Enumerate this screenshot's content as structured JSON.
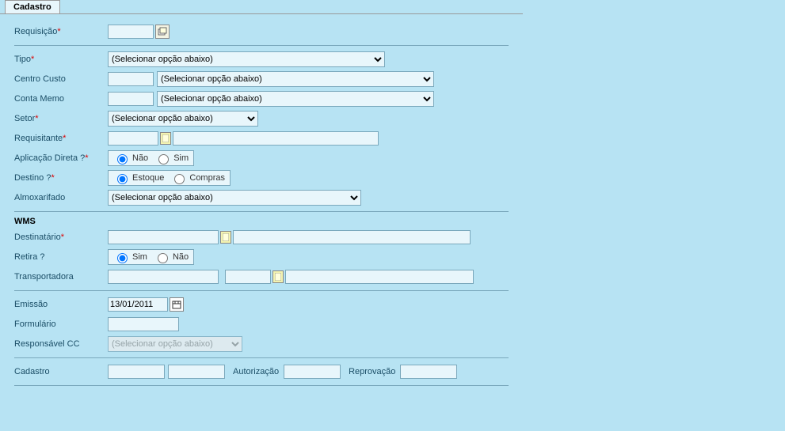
{
  "tab": {
    "title": "Cadastro"
  },
  "fields": {
    "requisicao": {
      "label": "Requisição",
      "value": ""
    },
    "tipo": {
      "label": "Tipo",
      "placeholder": "(Selecionar opção abaixo)"
    },
    "centro_custo": {
      "label": "Centro Custo",
      "code": "",
      "placeholder": "(Selecionar opção abaixo)"
    },
    "conta_memo": {
      "label": "Conta Memo",
      "code": "",
      "placeholder": "(Selecionar opção abaixo)"
    },
    "setor": {
      "label": "Setor",
      "placeholder": "(Selecionar opção abaixo)"
    },
    "requisitante": {
      "label": "Requisitante",
      "code": "",
      "name": ""
    },
    "aplicacao_direta": {
      "label": "Aplicação Direta ?",
      "opt_no": "Não",
      "opt_yes": "Sim"
    },
    "destino": {
      "label": "Destino ?",
      "opt_estoque": "Estoque",
      "opt_compras": "Compras"
    },
    "almoxarifado": {
      "label": "Almoxarifado",
      "placeholder": "(Selecionar opção abaixo)"
    }
  },
  "wms": {
    "title": "WMS",
    "destinatario": {
      "label": "Destinatário",
      "code": "",
      "name": ""
    },
    "retira": {
      "label": "Retira ?",
      "opt_yes": "Sim",
      "opt_no": "Não"
    },
    "transportadora": {
      "label": "Transportadora",
      "code1": "",
      "code2": "",
      "name": ""
    }
  },
  "footer": {
    "emissao": {
      "label": "Emissão",
      "value": "13/01/2011"
    },
    "formulario": {
      "label": "Formulário",
      "value": ""
    },
    "responsavel_cc": {
      "label": "Responsável CC",
      "placeholder": "(Selecionar opção abaixo)"
    },
    "cadastro": {
      "label": "Cadastro",
      "v1": "",
      "v2": ""
    },
    "autorizacao": {
      "label": "Autorização",
      "value": ""
    },
    "reprovacao": {
      "label": "Reprovação",
      "value": ""
    }
  }
}
